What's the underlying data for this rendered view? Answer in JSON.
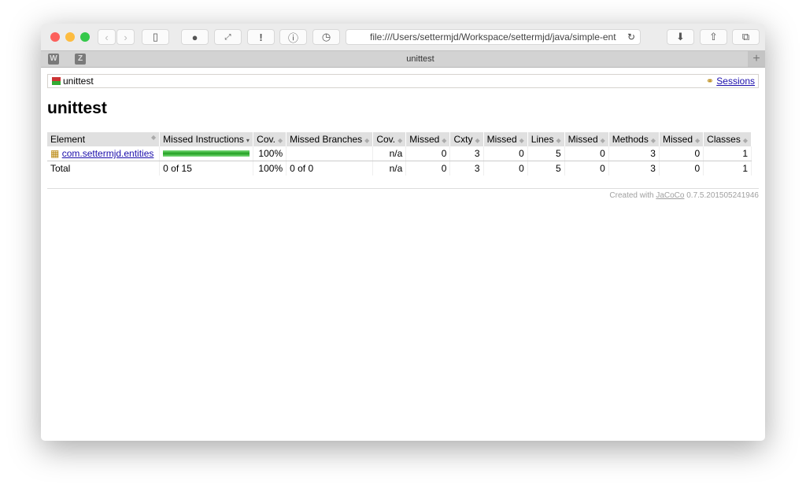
{
  "browser": {
    "url": "file:///Users/settermjd/Workspace/settermjd/java/simple-ent",
    "tab_title": "unittest",
    "pinned_tabs": [
      "W",
      "Z"
    ]
  },
  "breadcrumb": {
    "current": "unittest",
    "sessions": "Sessions"
  },
  "page_title": "unittest",
  "table": {
    "headers": [
      "Element",
      "Missed Instructions",
      "Cov.",
      "Missed Branches",
      "Cov.",
      "Missed",
      "Cxty",
      "Missed",
      "Lines",
      "Missed",
      "Methods",
      "Missed",
      "Classes"
    ],
    "rows": [
      {
        "cells": [
          "com.settermjd.entities",
          "",
          "100%",
          "",
          "n/a",
          "0",
          "3",
          "0",
          "5",
          "0",
          "3",
          "0",
          "1"
        ],
        "coverage": 1.0
      }
    ],
    "total": [
      "Total",
      "0 of 15",
      "100%",
      "0 of 0",
      "n/a",
      "0",
      "3",
      "0",
      "5",
      "0",
      "3",
      "0",
      "1"
    ]
  },
  "footer": {
    "prefix": "Created with ",
    "link": "JaCoCo",
    "version": " 0.7.5.201505241946"
  }
}
